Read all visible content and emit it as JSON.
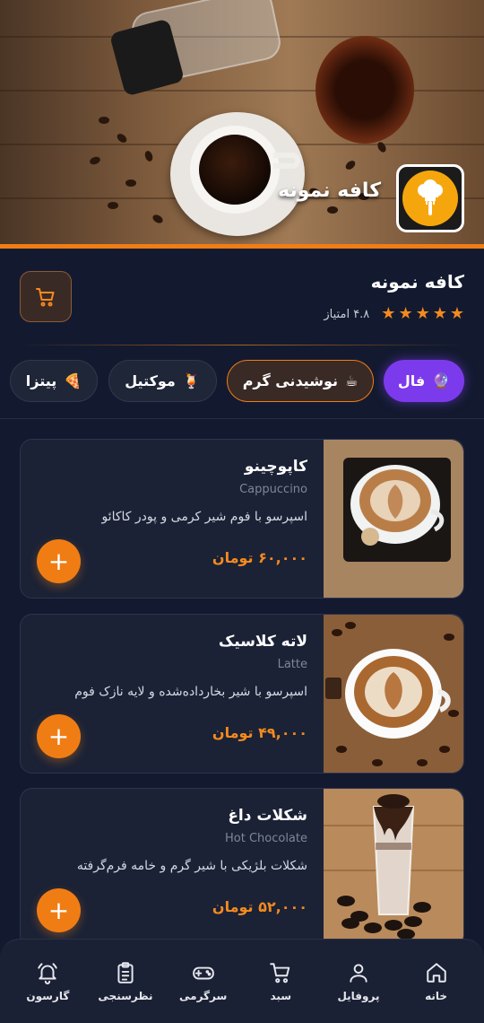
{
  "hero": {
    "title": "کافه نمونه"
  },
  "info": {
    "name": "کافه نمونه",
    "rating_label": "۴.۸ امتیاز",
    "stars": 5
  },
  "categories": [
    {
      "label": "فال",
      "emoji": "🔮"
    },
    {
      "label": "نوشیدنی گرم",
      "emoji": "☕"
    },
    {
      "label": "موکتیل",
      "emoji": "🍹"
    },
    {
      "label": "پیتزا",
      "emoji": "🍕"
    }
  ],
  "products": [
    {
      "name": "کاپوچینو",
      "subtitle": "Cappuccino",
      "description": "اسپرسو با فوم شیر کرمی و پودر کاکائو",
      "price": "۶۰,۰۰۰ تومان",
      "add": "+"
    },
    {
      "name": "لاته کلاسیک",
      "subtitle": "Latte",
      "description": "اسپرسو با شیر بخارداده‌شده و لایه نازک فوم",
      "price": "۴۹,۰۰۰ تومان",
      "add": "+"
    },
    {
      "name": "شکلات داغ",
      "subtitle": "Hot Chocolate",
      "description": "شکلات بلژیکی با شیر گرم و خامه فرم‌گرفته",
      "price": "۵۲,۰۰۰ تومان",
      "add": "+"
    }
  ],
  "nav": [
    {
      "label": "خانه",
      "icon": "home-icon"
    },
    {
      "label": "پروفایل",
      "icon": "user-icon"
    },
    {
      "label": "سبد",
      "icon": "cart-icon"
    },
    {
      "label": "سرگرمی",
      "icon": "gamepad-icon"
    },
    {
      "label": "نظرسنجی",
      "icon": "clipboard-icon"
    },
    {
      "label": "گارسون",
      "icon": "bell-icon"
    }
  ],
  "colors": {
    "accent": "#f07d14",
    "fal": "#7c3aed",
    "background": "#131a2f"
  }
}
